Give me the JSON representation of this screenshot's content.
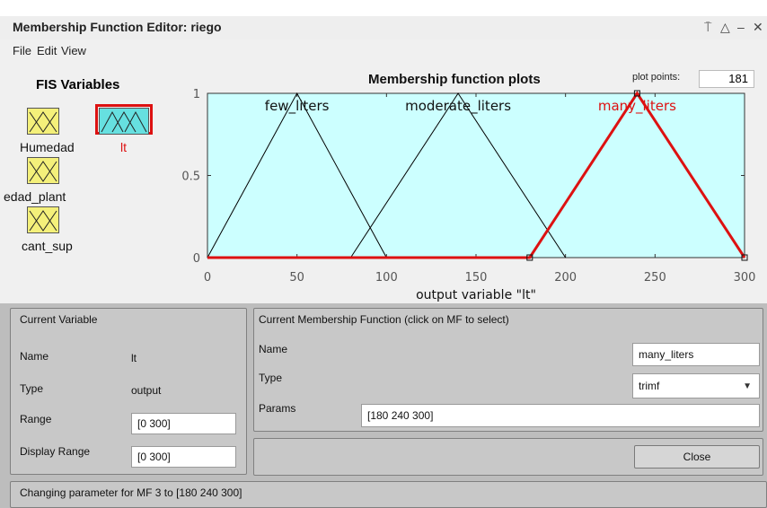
{
  "window": {
    "title": "Membership Function Editor: riego",
    "controls": [
      "⍑",
      "△",
      "–",
      "✕"
    ]
  },
  "menu": [
    "File",
    "Edit",
    "View"
  ],
  "fis": {
    "title": "FIS Variables",
    "inputs": [
      "Humedad",
      "edad_plant",
      "cant_sup"
    ],
    "output": "lt",
    "selected_color": "#dd1111"
  },
  "plot": {
    "title": "Membership function plots",
    "plot_points_label": "plot points:",
    "plot_points_value": "181",
    "xlabel": "output variable \"lt\""
  },
  "chart_data": {
    "type": "line",
    "title": "Membership function plots",
    "xlabel": "output variable \"lt\"",
    "ylabel": "",
    "xlim": [
      0,
      300
    ],
    "ylim": [
      0,
      1
    ],
    "xticks": [
      0,
      50,
      100,
      150,
      200,
      250,
      300
    ],
    "yticks": [
      0,
      0.5,
      1
    ],
    "background": "#ccffff",
    "series": [
      {
        "name": "few_liters",
        "x": [
          0,
          50,
          100
        ],
        "y": [
          0,
          1,
          0
        ],
        "color": "#000000",
        "selected": false
      },
      {
        "name": "moderate_liters",
        "x": [
          80,
          140,
          200
        ],
        "y": [
          0,
          1,
          0
        ],
        "color": "#000000",
        "selected": false
      },
      {
        "name": "many_liters",
        "x": [
          0,
          180,
          240,
          300
        ],
        "y": [
          0,
          0,
          1,
          0
        ],
        "color": "#dd1111",
        "selected": true
      }
    ]
  },
  "current_variable": {
    "title": "Current Variable",
    "name_label": "Name",
    "name_value": "lt",
    "type_label": "Type",
    "type_value": "output",
    "range_label": "Range",
    "range_value": "[0 300]",
    "display_range_label": "Display Range",
    "display_range_value": "[0 300]"
  },
  "current_mf": {
    "title": "Current Membership Function (click on MF to select)",
    "name_label": "Name",
    "name_value": "many_liters",
    "type_label": "Type",
    "type_value": "trimf",
    "params_label": "Params",
    "params_value": "[180 240 300]"
  },
  "close_label": "Close",
  "status": "Changing parameter for MF 3 to  [180 240 300]"
}
